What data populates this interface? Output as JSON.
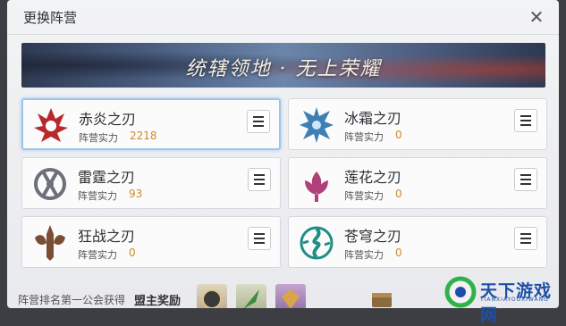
{
  "dialog": {
    "title": "更换阵营",
    "close_icon": "close-icon"
  },
  "banner": {
    "text": "统辖领地 · 无上荣耀"
  },
  "power_label": "阵营实力",
  "factions": [
    {
      "name": "赤炎之刃",
      "power": "2218",
      "icon": "flame-crest-icon",
      "color": "#b8292b",
      "selected": true
    },
    {
      "name": "冰霜之刃",
      "power": "0",
      "icon": "frost-crest-icon",
      "color": "#3e7fb4",
      "selected": false
    },
    {
      "name": "雷霆之刃",
      "power": "93",
      "icon": "thunder-crest-icon",
      "color": "#6d7079",
      "selected": false
    },
    {
      "name": "莲花之刃",
      "power": "0",
      "icon": "lotus-crest-icon",
      "color": "#b0407a",
      "selected": false
    },
    {
      "name": "狂战之刃",
      "power": "0",
      "icon": "berserker-crest-icon",
      "color": "#7a4e35",
      "selected": false
    },
    {
      "name": "苍穹之刃",
      "power": "0",
      "icon": "sky-crest-icon",
      "color": "#1f8e83",
      "selected": false
    }
  ],
  "menu_icon": "menu-icon",
  "reward": {
    "text": "阵营排名第一公会获得",
    "strong": "盟主奖励",
    "items": [
      "badge-item-icon",
      "green-blade-item-icon",
      "purple-rank-item-icon"
    ],
    "chest_icon": "chest-icon"
  },
  "watermark": {
    "text": "天下游戏网",
    "sub": "TIANXIAYOUXIWANG"
  }
}
